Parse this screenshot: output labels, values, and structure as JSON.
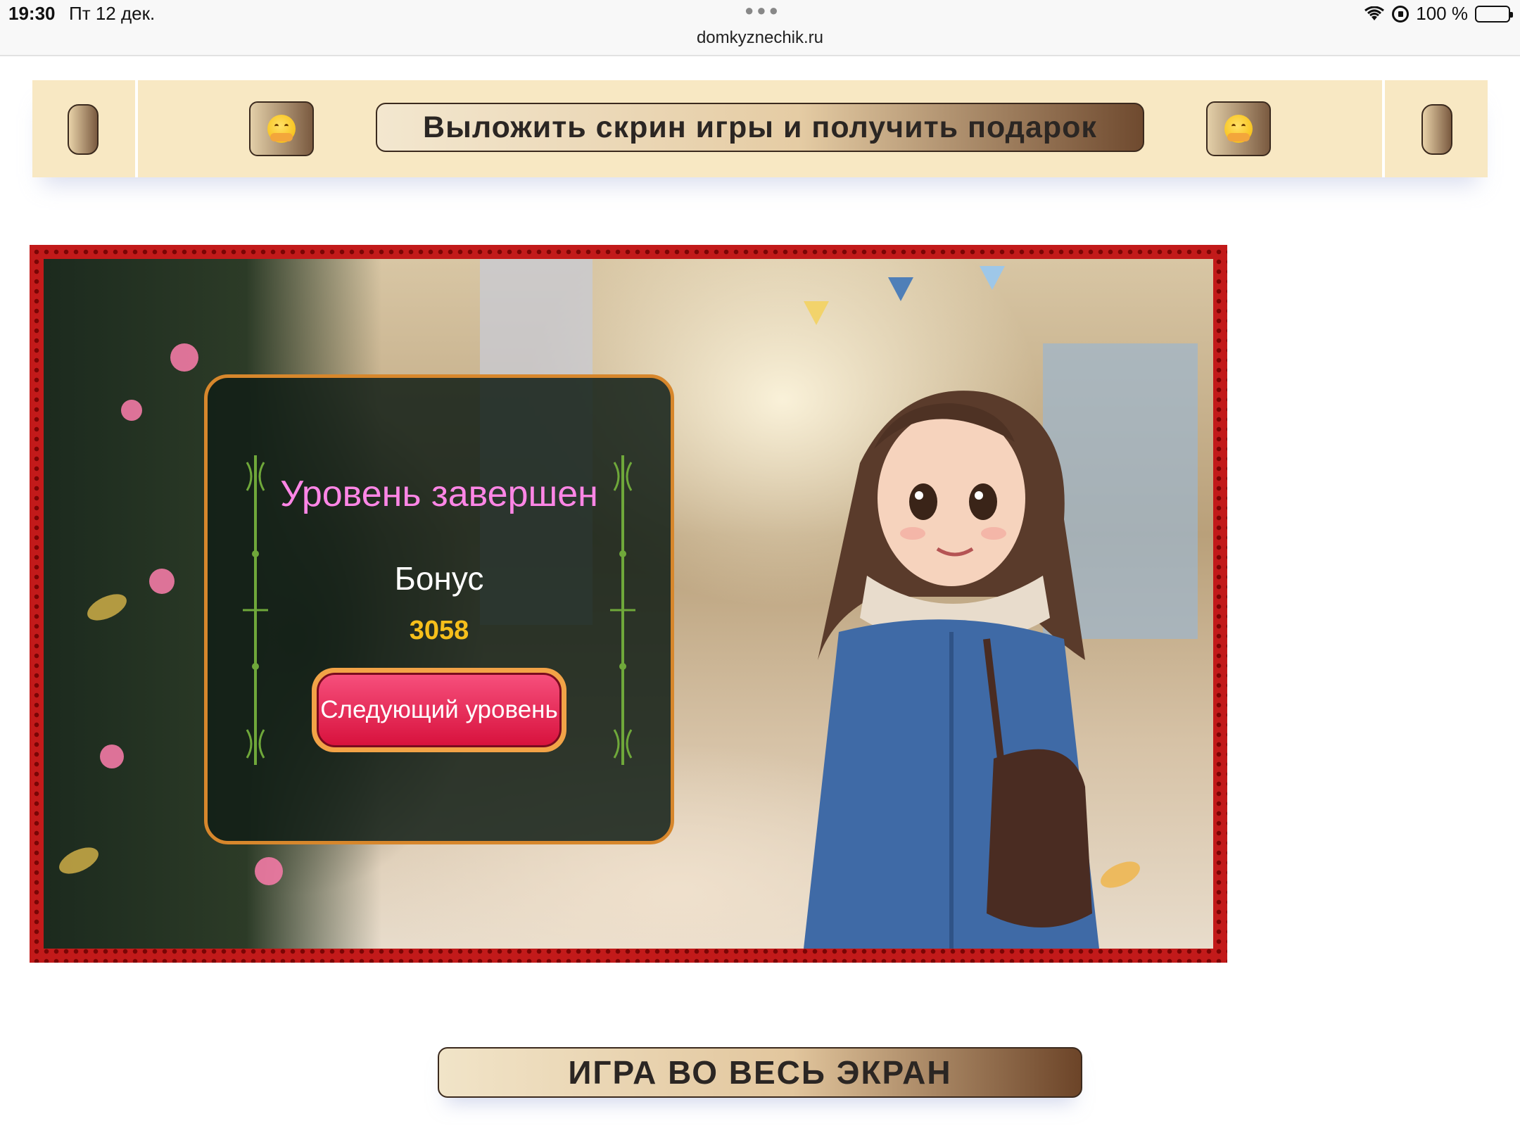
{
  "status_bar": {
    "time": "19:30",
    "date": "Пт 12 дек.",
    "url": "domkyznechik.ru",
    "battery": "100 %"
  },
  "banner": {
    "cta_label": "Выложить скрин игры и получить подарок",
    "emoji_icon": "hugging-face-emoji"
  },
  "game": {
    "dialog_title": "Уровень завершен",
    "bonus_label": "Бонус",
    "bonus_value": "3058",
    "next_level_label": "Следующий уровень"
  },
  "fullscreen_label": "ИГРА ВО ВЕСЬ ЭКРАН",
  "colors": {
    "banner_bg": "#f8e8c3",
    "frame_red": "#c21a1a",
    "dialog_title": "#ff86e6",
    "bonus_value": "#f6bf1b",
    "button_pink": "#e8204f",
    "button_gold": "#f2a347"
  }
}
